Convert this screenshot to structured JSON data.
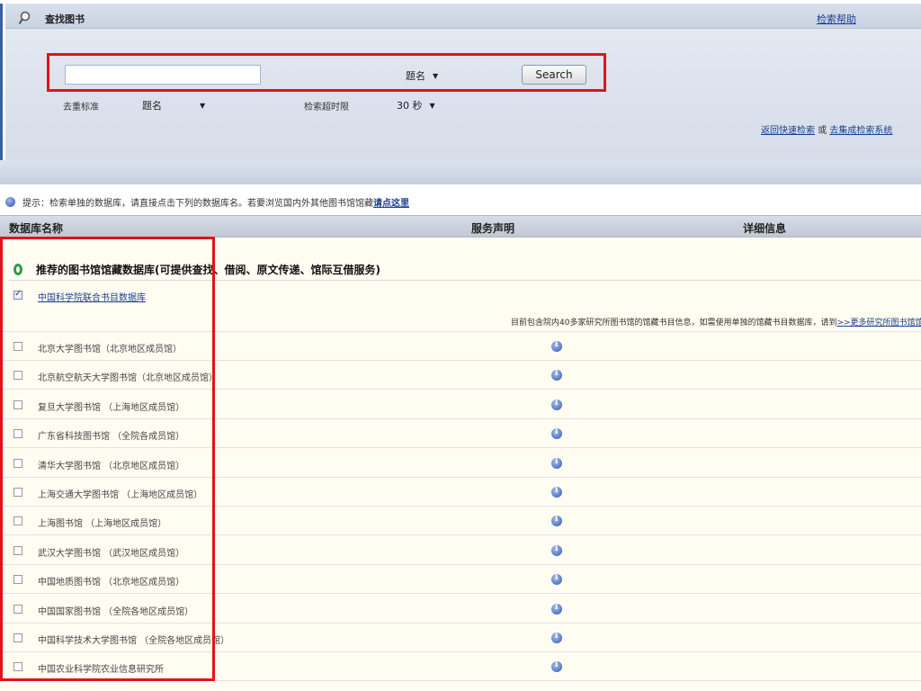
{
  "header": {
    "title": "查找图书",
    "help_link": "检索帮助"
  },
  "search": {
    "input_value": "",
    "field_select": "题名",
    "button_label": "Search"
  },
  "options": {
    "dedup_label": "去重标准",
    "dedup_value": "题名",
    "timeout_label": "检索超时限",
    "timeout_value": "30 秒"
  },
  "links": {
    "quick_search": "返回快速检索",
    "or": "或",
    "integrated": "去集成检索系统"
  },
  "tip": {
    "text": "提示：检索单独的数据库，请直接点击下列的数据库名。若要浏览国内外其他图书馆馆藏",
    "link": "请点这里"
  },
  "table": {
    "col_name": "数据库名称",
    "col_service": "服务声明",
    "col_detail": "详细信息"
  },
  "group": {
    "title": "推荐的图书馆馆藏数据库(可提供查找、借阅、原文传递、馆际互借服务)"
  },
  "desc": {
    "text": "目前包含院内40多家研究所图书馆的馆藏书目信息，如需使用单独的馆藏书目数据库，请到",
    "link": ">>更多研究所图书馆馆藏"
  },
  "rows": [
    {
      "label": "中国科学院联合书目数据库",
      "checked": true
    },
    {
      "label": "北京大学图书馆（北京地区成员馆）",
      "checked": false
    },
    {
      "label": "北京航空航天大学图书馆（北京地区成员馆）",
      "checked": false
    },
    {
      "label": "复旦大学图书馆 （上海地区成员馆）",
      "checked": false
    },
    {
      "label": "广东省科技图书馆 （全院各成员馆）",
      "checked": false
    },
    {
      "label": "清华大学图书馆 （北京地区成员馆）",
      "checked": false
    },
    {
      "label": "上海交通大学图书馆 （上海地区成员馆）",
      "checked": false
    },
    {
      "label": "上海图书馆 （上海地区成员馆）",
      "checked": false
    },
    {
      "label": "武汉大学图书馆 （武汉地区成员馆）",
      "checked": false
    },
    {
      "label": "中国地质图书馆 （北京地区成员馆）",
      "checked": false
    },
    {
      "label": "中国国家图书馆 （全院各地区成员馆）",
      "checked": false
    },
    {
      "label": "中国科学技术大学图书馆 （全院各地区成员馆）",
      "checked": false
    },
    {
      "label": "中国农业科学院农业信息研究所",
      "checked": false
    }
  ],
  "colors": {
    "highlight_red": "#e0141b",
    "link_blue": "#1a3f8f",
    "panel_bg": "#d6dde9",
    "content_bg": "#fffdf2"
  }
}
